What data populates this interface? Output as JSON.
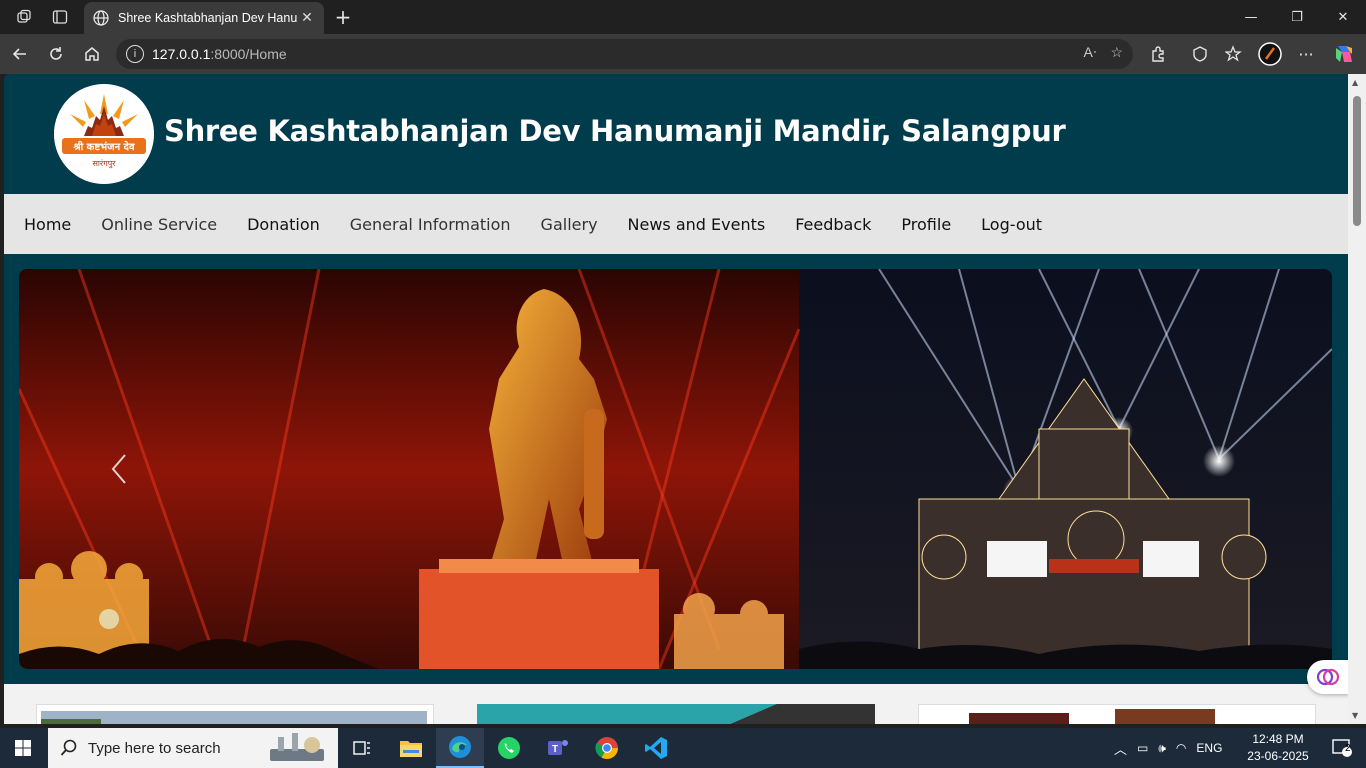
{
  "browser": {
    "tab_title": "Shree Kashtabhanjan Dev Hanum",
    "url_host": "127.0.0.1",
    "url_path": ":8000/Home"
  },
  "site": {
    "title": "Shree Kashtabhanjan Dev Hanumanji Mandir, Salangpur",
    "logo_text_top": "श्री कष्टभंजन देव",
    "logo_text_bottom": "सारंगपुर"
  },
  "menu": {
    "items": [
      {
        "label": "Home"
      },
      {
        "label": "Online Service"
      },
      {
        "label": "Donation"
      },
      {
        "label": "General Information"
      },
      {
        "label": "Gallery"
      },
      {
        "label": "News and Events"
      },
      {
        "label": "Feedback"
      },
      {
        "label": "Profile"
      },
      {
        "label": "Log-out"
      }
    ]
  },
  "taskbar": {
    "search_placeholder": "Type here to search",
    "language": "ENG",
    "time": "12:48 PM",
    "date": "23-06-2025",
    "notification_count": "2"
  },
  "colors": {
    "header_bg": "#013c4d",
    "menu_bg": "#e5e5e5",
    "accent_orange": "#e8711c"
  }
}
